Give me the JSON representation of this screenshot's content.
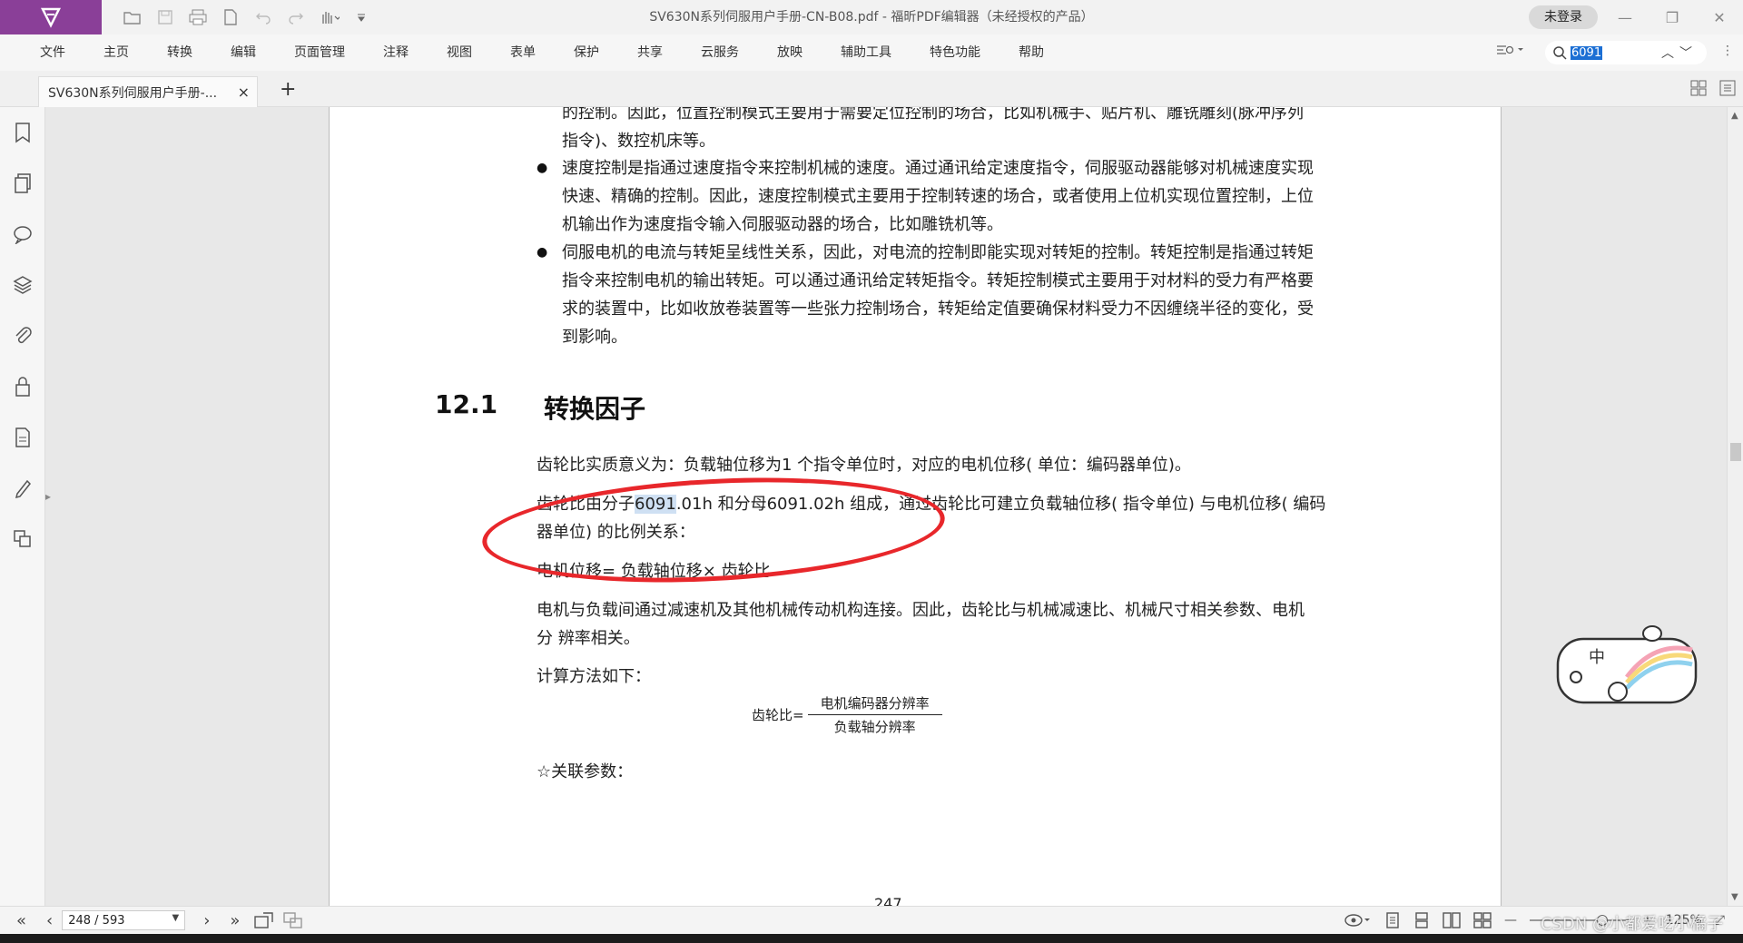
{
  "app": {
    "window_title": "SV630N系列伺服用户手册-CN-B08.pdf - 福昕PDF编辑器（未经授权的产品）",
    "login_label": "未登录",
    "brand_color": "#8a3f98"
  },
  "menu": [
    "文件",
    "主页",
    "转换",
    "编辑",
    "页面管理",
    "注释",
    "视图",
    "表单",
    "保护",
    "共享",
    "云服务",
    "放映",
    "辅助工具",
    "特色功能",
    "帮助"
  ],
  "search": {
    "value": "6091"
  },
  "tab": {
    "label": "SV630N系列伺服用户手册-...",
    "close": "×",
    "add": "+"
  },
  "document": {
    "p1_l1": "的控制。因此，位置控制模式主要用于需要定位控制的场合，比如机械手、贴片机、雕铣雕刻(脉冲序列",
    "p1_l2": "指令)、数控机床等。",
    "b2_l1": "速度控制是指通过速度指令来控制机械的速度。通过通讯给定速度指令，伺服驱动器能够对机械速度实现",
    "b2_l2": "快速、精确的控制。因此，速度控制模式主要用于控制转速的场合，或者使用上位机实现位置控制，上位",
    "b2_l3": "机输出作为速度指令输入伺服驱动器的场合，比如雕铣机等。",
    "b3_l1": "伺服电机的电流与转矩呈线性关系，因此，对电流的控制即能实现对转矩的控制。转矩控制是指通过转矩",
    "b3_l2": "指令来控制电机的输出转矩。可以通过通讯给定转矩指令。转矩控制模式主要用于对材料的受力有严格要",
    "b3_l3": "求的装置中，比如收放卷装置等一些张力控制场合，转矩给定值要确保材料受力不因缠绕半径的变化，受",
    "b3_l4": "到影响。",
    "heading_num": "12.1",
    "heading_title": "转换因子",
    "para1": "齿轮比实质意义为：负载轴位移为1 个指令单位时，对应的电机位移( 单位：编码器单位)。",
    "para2_pre": "齿轮比由分子",
    "para2_hl": "6091",
    "para2_post": ".01h 和分母6091.02h 组成，通过齿轮比可建立负载轴位移( 指令单位) 与电机位移( 编码",
    "para2_l2": "器单位) 的比例关系：",
    "para3": "电机位移= 负载轴位移× 齿轮比",
    "para4_l1": "电机与负载间通过减速机及其他机械传动机构连接。因此，齿轮比与机械减速比、机械尺寸相关参数、电机",
    "para4_l2": "分 辨率相关。",
    "para5": "计算方法如下：",
    "formula_lhs": "齿轮比=",
    "formula_num": "电机编码器分辨率",
    "formula_den": "负载轴分辨率",
    "para6": "☆关联参数：",
    "page_number_peek": "247"
  },
  "status": {
    "page_input": "248 / 593",
    "zoom": "125%",
    "watermark": "CSDN @小都爱吃小橘子"
  },
  "colors": {
    "annotation_oval": "#e8272b",
    "search_highlight": "#1c6fd4"
  }
}
